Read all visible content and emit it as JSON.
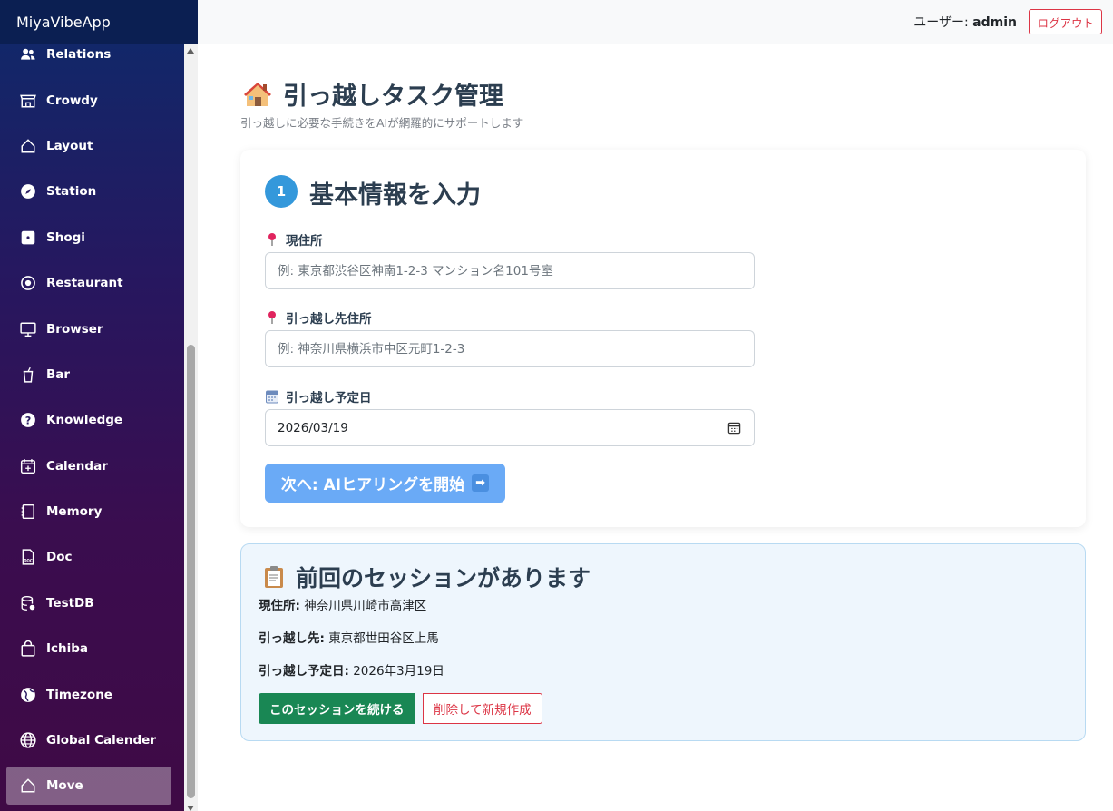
{
  "app": {
    "brand": "MiyaVibeApp"
  },
  "header": {
    "user_prefix": "ユーザー: ",
    "user_name": "admin",
    "logout_label": "ログアウト"
  },
  "sidebar": {
    "items": [
      {
        "label": "Relations",
        "icon": "people-icon"
      },
      {
        "label": "Crowdy",
        "icon": "shop-icon"
      },
      {
        "label": "Layout",
        "icon": "house-outline-icon"
      },
      {
        "label": "Station",
        "icon": "compass-icon"
      },
      {
        "label": "Shogi",
        "icon": "square-dot-icon"
      },
      {
        "label": "Restaurant",
        "icon": "gear-circle-icon"
      },
      {
        "label": "Browser",
        "icon": "monitor-icon"
      },
      {
        "label": "Bar",
        "icon": "cup-icon"
      },
      {
        "label": "Knowledge",
        "icon": "question-circle-icon"
      },
      {
        "label": "Calendar",
        "icon": "calendar-plus-icon"
      },
      {
        "label": "Memory",
        "icon": "journal-icon"
      },
      {
        "label": "Doc",
        "icon": "doc-file-icon"
      },
      {
        "label": "TestDB",
        "icon": "database-icon"
      },
      {
        "label": "Ichiba",
        "icon": "bag-icon"
      },
      {
        "label": "Timezone",
        "icon": "globe-americas-icon"
      },
      {
        "label": "Global Calender",
        "icon": "globe-icon"
      },
      {
        "label": "Move",
        "icon": "house-outline-icon",
        "active": true
      }
    ]
  },
  "main": {
    "title": "引っ越しタスク管理",
    "subtitle": "引っ越しに必要な手続きをAIが網羅的にサポートします",
    "step": {
      "number": "1",
      "title": "基本情報を入力",
      "current_address": {
        "label": "現住所",
        "placeholder": "例: 東京都渋谷区神南1-2-3 マンション名101号室",
        "value": ""
      },
      "new_address": {
        "label": "引っ越し先住所",
        "placeholder": "例: 神奈川県横浜市中区元町1-2-3",
        "value": ""
      },
      "move_date": {
        "label": "引っ越し予定日",
        "value": "2026/03/19"
      },
      "next_button": "次へ: AIヒアリングを開始",
      "next_arrow": "➡"
    },
    "session": {
      "title": "前回のセッションがあります",
      "current_label": "現住所:",
      "current_value": " 神奈川県川崎市高津区",
      "dest_label": "引っ越し先:",
      "dest_value": " 東京都世田谷区上馬",
      "date_label": "引っ越し予定日:",
      "date_value": " 2026年3月19日",
      "continue_button": "このセッションを続ける",
      "delete_button": "削除して新規作成"
    }
  },
  "colors": {
    "accent": "#3498db",
    "next_button": "#6aaaf6",
    "continue_button": "#198754",
    "danger": "#dc3545"
  }
}
